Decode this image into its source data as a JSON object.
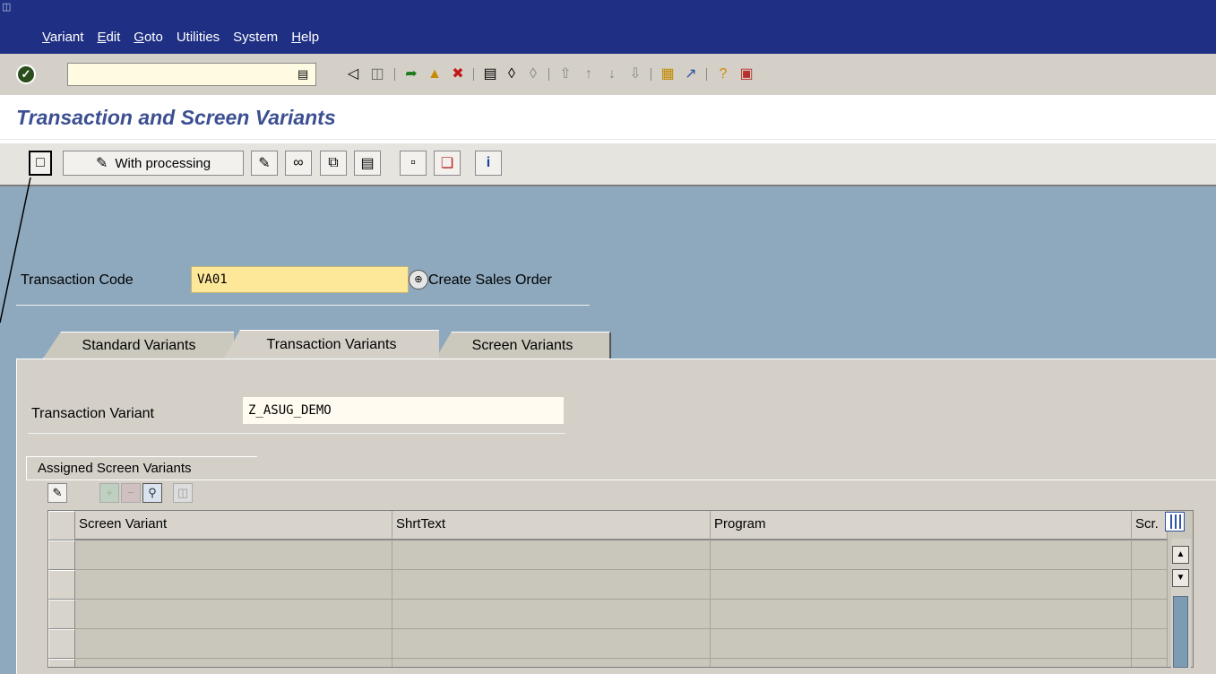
{
  "menu": {
    "items": [
      {
        "ul": "V",
        "rest": "ariant"
      },
      {
        "ul": "E",
        "rest": "dit"
      },
      {
        "ul": "G",
        "rest": "oto"
      },
      {
        "ul": "",
        "rest": "Utilities"
      },
      {
        "ul": "",
        "rest": "System"
      },
      {
        "ul": "H",
        "rest": "elp"
      }
    ]
  },
  "title": "Transaction and Screen Variants",
  "app_toolbar": {
    "with_processing_label": "With processing"
  },
  "transaction_code": {
    "label": "Transaction Code",
    "value": "VA01",
    "description": "Create Sales Order"
  },
  "tabs": [
    {
      "label": "Standard Variants",
      "active": false
    },
    {
      "label": "Transaction Variants",
      "active": true
    },
    {
      "label": "Screen Variants",
      "active": false
    }
  ],
  "transaction_variant": {
    "label": "Transaction Variant",
    "value": "Z_ASUG_DEMO"
  },
  "assigned_group": {
    "title": "Assigned Screen Variants"
  },
  "table": {
    "columns": [
      "Screen Variant",
      "ShrtText",
      "Program",
      "Scr."
    ],
    "row_count": 5
  },
  "colors": {
    "menubar": "#1f2f84",
    "title": "#3c4f92",
    "main_bg": "#8ea9be",
    "input_required": "#fde89a"
  }
}
